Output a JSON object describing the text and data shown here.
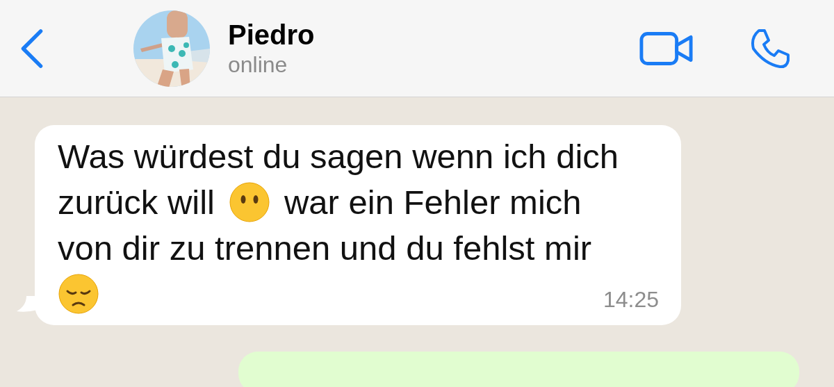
{
  "header": {
    "name": "Piedro",
    "status": "online"
  },
  "messages": [
    {
      "kind": "incoming",
      "time": "14:25",
      "lines": [
        [
          {
            "kind": "text",
            "text": "Was würdest du sagen wenn ich dich"
          }
        ],
        [
          {
            "kind": "text",
            "text": "zurück will"
          },
          {
            "kind": "neutral-face"
          },
          {
            "kind": "text",
            "text": "war ein Fehler mich"
          }
        ],
        [
          {
            "kind": "text",
            "text": "von dir zu trennen und du fehlst mir"
          }
        ],
        [
          {
            "kind": "sad-face"
          }
        ]
      ]
    },
    {
      "kind": "outgoing"
    }
  ]
}
